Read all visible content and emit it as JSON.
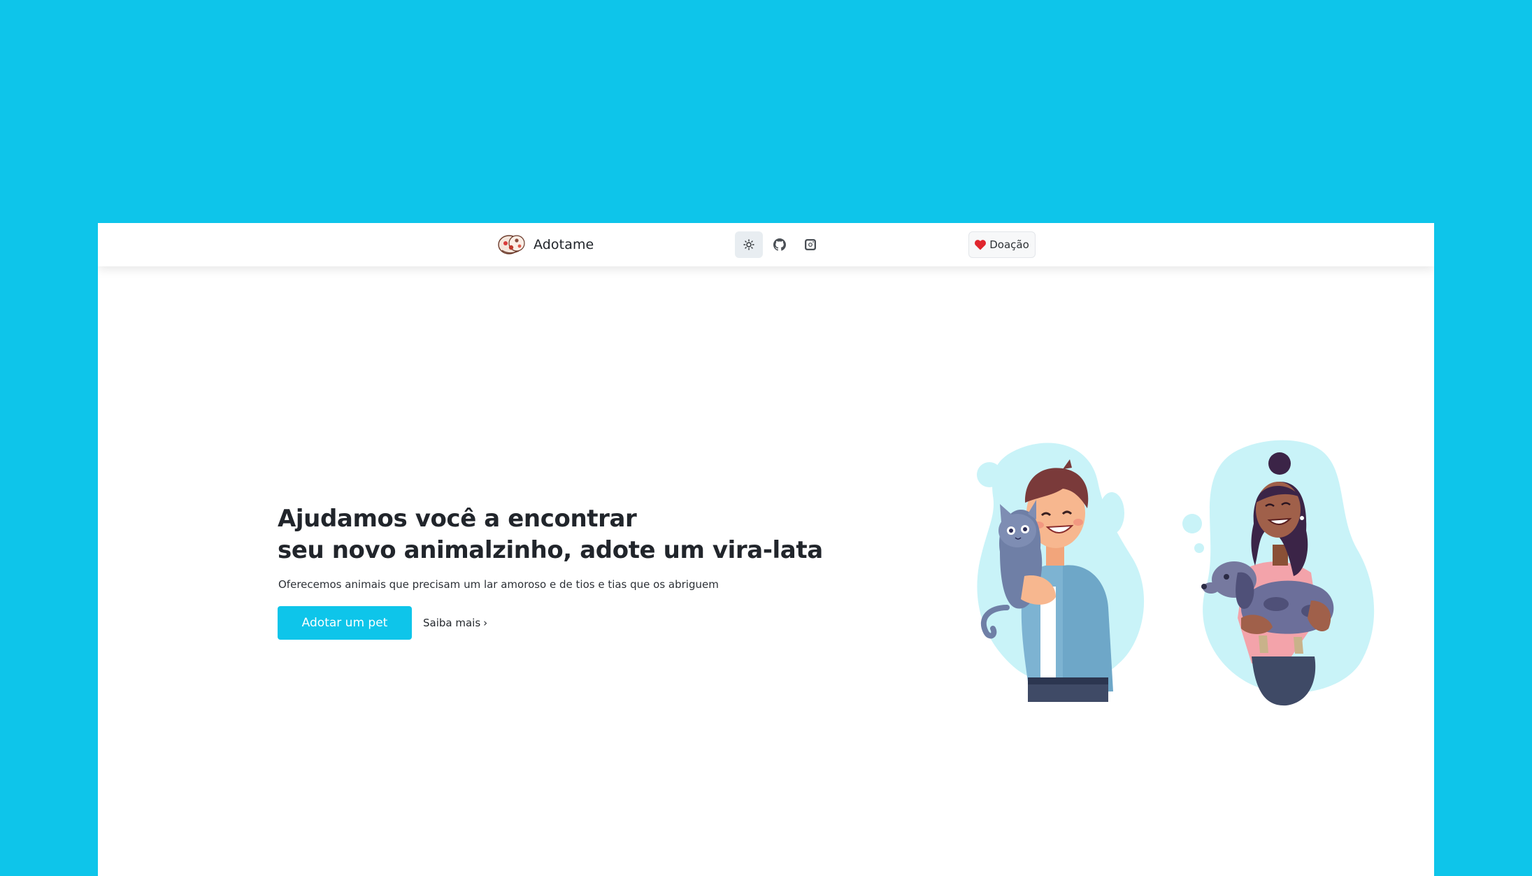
{
  "colors": {
    "accent": "#0ec5ea",
    "background": "#ffffff",
    "donate_heart": "#e0262e"
  },
  "navbar": {
    "brand": {
      "name": "Adotame",
      "logo_icon": "pets-logo-icon"
    },
    "theme_toggle": {
      "icon": "sun-icon"
    },
    "github": {
      "icon": "github-icon"
    },
    "instagram": {
      "icon": "instagram-icon"
    },
    "donate": {
      "label": "Doação",
      "icon": "heart-icon"
    }
  },
  "hero": {
    "title_line1": "Ajudamos você a encontrar",
    "title_line2": "seu novo animalzinho, adote um vira-lata",
    "subtitle": "Oferecemos animais que precisam um lar amoroso e de tios e tias que os abriguem",
    "primary_button": "Adotar um pet",
    "secondary_link": "Saiba mais",
    "secondary_chevron": "›",
    "illustration": "people-holding-pets-illustration"
  }
}
